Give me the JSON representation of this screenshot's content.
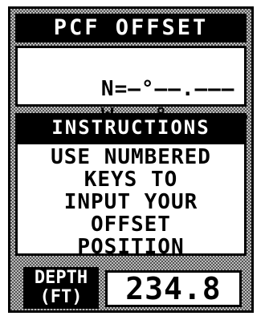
{
  "pcf_offset": {
    "title": "PCF OFFSET",
    "north": {
      "label": "N",
      "value": "=–°––.–––"
    },
    "west": {
      "label": "W",
      "value": "–––°––.–––"
    }
  },
  "instructions": {
    "title": "INSTRUCTIONS",
    "lines": [
      "USE NUMBERED",
      "KEYS TO",
      "INPUT YOUR",
      "OFFSET",
      "POSITION"
    ]
  },
  "depth": {
    "label_line1": "DEPTH",
    "label_line2": "(FT)",
    "value": "234.8"
  }
}
